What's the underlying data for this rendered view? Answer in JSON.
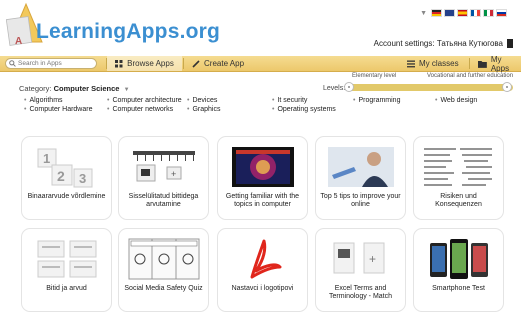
{
  "header": {
    "logo_text": "LearningApps.org",
    "account_label": "Account settings: Татьяна Кутюгова"
  },
  "languages": [
    "de",
    "en",
    "es",
    "fr",
    "it",
    "ru"
  ],
  "navbar": {
    "search_placeholder": "Search in Apps",
    "browse_label": "Browse Apps",
    "create_label": "Create App",
    "classes_label": "My classes",
    "myapps_label": "My Apps"
  },
  "filter": {
    "category_prefix": "Category:",
    "category_value": "Computer Science",
    "levels_label": "Levels:",
    "level_min_label": "Elementary level",
    "level_max_label": "Vocational and further education",
    "level_range": [
      0,
      1
    ]
  },
  "topics": [
    "Algorithms",
    "Computer Hardware",
    "Computer architecture",
    "Computer networks",
    "Devices",
    "Graphics",
    "It security",
    "Operating systems",
    "Programming",
    "Web design"
  ],
  "apps": [
    {
      "title": "Binaararvude võrdlemine"
    },
    {
      "title": "Sisselülitatud bittidega arvutamine"
    },
    {
      "title": "Getting familiar with the topics in computer"
    },
    {
      "title": "Top 5 tips to improve your online"
    },
    {
      "title": "Risiken und Konsequenzen"
    },
    {
      "title": "Bitid ja arvud"
    },
    {
      "title": "Social Media Safety Quiz"
    },
    {
      "title": "Nastavci i logotipovi"
    },
    {
      "title": "Excel Terms and Terminology - Match"
    },
    {
      "title": "Smartphone Test"
    }
  ],
  "colors": {
    "brand_blue": "#3b8fd1",
    "navbar_yellow": "#f0cf77",
    "slider_yellow": "#e2c96a"
  }
}
